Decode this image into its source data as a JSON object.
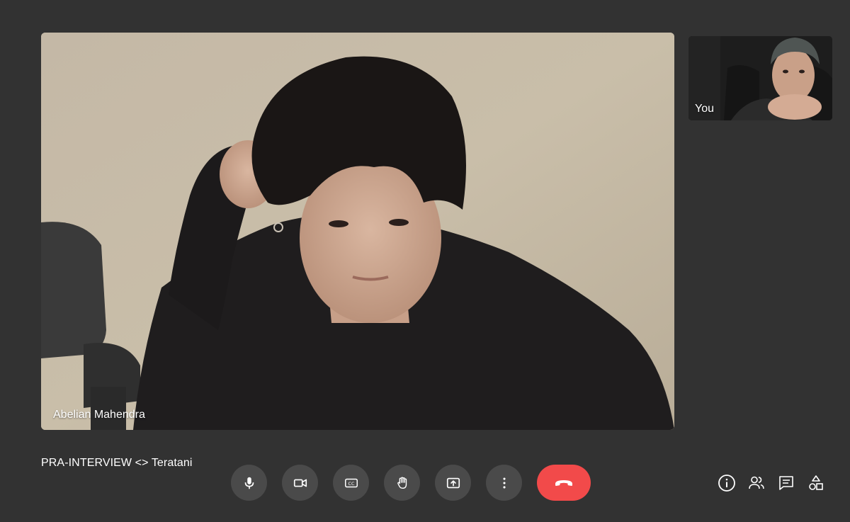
{
  "meeting": {
    "title": "PRA-INTERVIEW <> Teratani"
  },
  "main_participant": {
    "name": "Abelian Mahendra"
  },
  "self_view": {
    "label": "You"
  },
  "controls": [
    {
      "id": "mic",
      "icon": "microphone-icon"
    },
    {
      "id": "camera",
      "icon": "video-camera-icon"
    },
    {
      "id": "captions",
      "icon": "closed-captions-icon",
      "label": "CC"
    },
    {
      "id": "raise-hand",
      "icon": "hand-icon"
    },
    {
      "id": "present",
      "icon": "present-screen-icon"
    },
    {
      "id": "more",
      "icon": "more-options-icon"
    },
    {
      "id": "leave",
      "icon": "end-call-icon"
    }
  ],
  "side_panel_icons": [
    {
      "id": "info",
      "icon": "info-icon"
    },
    {
      "id": "people",
      "icon": "people-icon"
    },
    {
      "id": "chat",
      "icon": "chat-icon"
    },
    {
      "id": "activities",
      "icon": "activities-icon"
    }
  ],
  "colors": {
    "background": "#323232",
    "button": "#4a4a4a",
    "end_call": "#f24a4a",
    "text": "#ffffff"
  }
}
